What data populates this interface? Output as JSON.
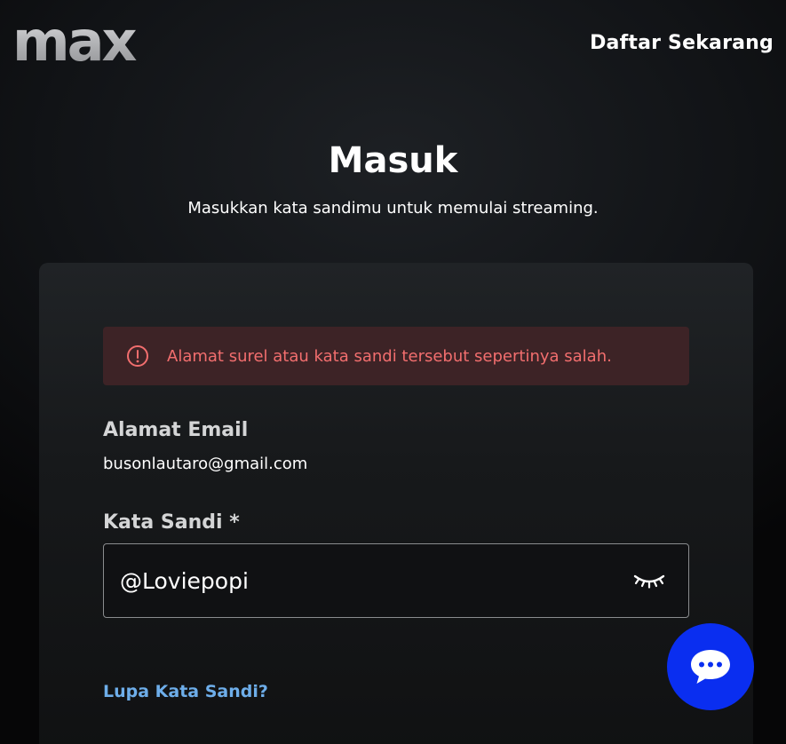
{
  "header": {
    "logo_text": "max",
    "signup_label": "Daftar Sekarang"
  },
  "login": {
    "title": "Masuk",
    "subtitle": "Masukkan kata sandimu untuk memulai streaming.",
    "error_message": "Alamat surel atau kata sandi tersebut sepertinya salah.",
    "email_label": "Alamat Email",
    "email_value": "busonlautaro@gmail.com",
    "password_label": "Kata Sandi *",
    "password_value": "@Loviepopi",
    "forgot_password_label": "Lupa Kata Sandi?"
  },
  "icons": {
    "error": "alert-circle-icon",
    "password_toggle": "eye-closed-icon",
    "chat": "chat-bubble-icon"
  },
  "colors": {
    "error_text": "#f26e6e",
    "error_background": "#3d2326",
    "link": "#6eaeea",
    "chat_button": "#0a2ef0"
  }
}
